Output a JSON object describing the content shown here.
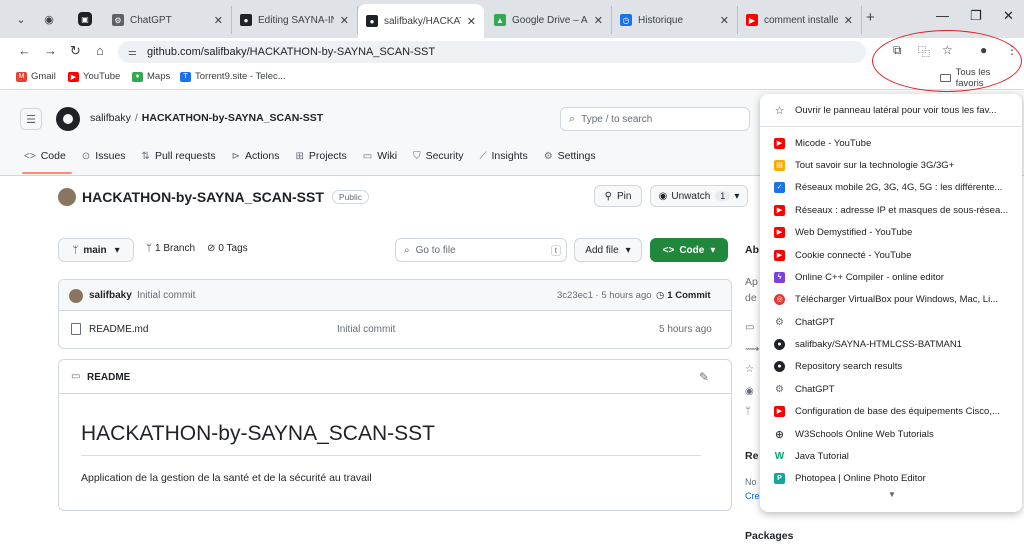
{
  "browser": {
    "tabs": [
      {
        "label": "ChatGPT",
        "fav": "chatgpt-icon",
        "color": "#5f6368"
      },
      {
        "label": "Editing SAYNA-IN",
        "fav": "github-icon",
        "color": "#1f2328"
      },
      {
        "label": "salifbaky/HACKAT",
        "fav": "github-icon",
        "color": "#1f2328"
      },
      {
        "label": "Google Drive – Ap",
        "fav": "drive-icon",
        "color": "#34a853"
      },
      {
        "label": "Historique",
        "fav": "history-icon",
        "color": "#1a73e8"
      },
      {
        "label": "comment installer",
        "fav": "youtube-icon",
        "color": "#ff0000"
      }
    ],
    "url": "github.com/salifbaky/HACKATHON-by-SAYNA_SCAN-SST",
    "bookmarks": [
      {
        "label": "Gmail",
        "color": "#ea4335"
      },
      {
        "label": "YouTube",
        "color": "#ff0000"
      },
      {
        "label": "Maps",
        "color": "#34a853"
      },
      {
        "label": "Torrent9.site - Telec...",
        "color": "#1a73e8"
      }
    ],
    "all_favorites_label": "Tous les favoris"
  },
  "github": {
    "owner": "salifbaky",
    "repo": "HACKATHON-by-SAYNA_SCAN-SST",
    "search_placeholder": "Type / to search",
    "nav": [
      "Code",
      "Issues",
      "Pull requests",
      "Actions",
      "Projects",
      "Wiki",
      "Security",
      "Insights",
      "Settings"
    ],
    "visibility": "Public",
    "pin_label": "Pin",
    "unwatch_label": "Unwatch",
    "watch_count": "1",
    "branch": "main",
    "branch_count": "1 Branch",
    "tag_count": "0 Tags",
    "goto_placeholder": "Go to file",
    "goto_key": "t",
    "add_file_label": "Add file",
    "code_label": "Code",
    "commit": {
      "user": "salifbaky",
      "message": "Initial commit",
      "sha": "3c23ec1 · 5 hours ago",
      "count": "1 Commit"
    },
    "files": [
      {
        "name": "README.md",
        "message": "Initial commit",
        "age": "5 hours ago"
      }
    ],
    "readme": {
      "label": "README",
      "title": "HACKATHON-by-SAYNA_SCAN-SST",
      "text": "Application de la gestion de la santé et de la sécurité au travail"
    },
    "sidebar": {
      "about": "Ab",
      "desc_1": "Ap",
      "desc_2": "de",
      "releases": "Re",
      "rel_1": "No",
      "rel_2": "Cre",
      "packages": "Packages"
    }
  },
  "favorites_menu": {
    "header": "Ouvrir le panneau latéral pour voir tous les fav...",
    "items": [
      {
        "label": "Micode - YouTube",
        "color": "#ff0000"
      },
      {
        "label": "Tout savoir sur la technologie 3G/3G+",
        "color": "#f9ab00"
      },
      {
        "label": "Réseaux mobile 2G, 3G, 4G, 5G : les différente...",
        "color": "#1a73e8"
      },
      {
        "label": "Réseaux : adresse IP et masques de sous-résea...",
        "color": "#ff0000"
      },
      {
        "label": "Web Demystified - YouTube",
        "color": "#ff0000"
      },
      {
        "label": "Cookie connecté - YouTube",
        "color": "#ff0000"
      },
      {
        "label": "Online C++ Compiler - online editor",
        "color": "#7b3fe4"
      },
      {
        "label": "Télécharger VirtualBox pour Windows, Mac, Li...",
        "color": "#e53935"
      },
      {
        "label": "ChatGPT",
        "color": "#5f6368"
      },
      {
        "label": "salifbaky/SAYNA-HTMLCSS-BATMAN1",
        "color": "#1f2328"
      },
      {
        "label": "Repository search results",
        "color": "#1f2328"
      },
      {
        "label": "ChatGPT",
        "color": "#5f6368"
      },
      {
        "label": "Configuration de base des équipements Cisco,...",
        "color": "#ff0000"
      },
      {
        "label": "W3Schools Online Web Tutorials",
        "color": "#3c4043"
      },
      {
        "label": "Java Tutorial",
        "color": "#04aa6d"
      },
      {
        "label": "Photopea | Online Photo Editor",
        "color": "#18a497"
      }
    ]
  }
}
